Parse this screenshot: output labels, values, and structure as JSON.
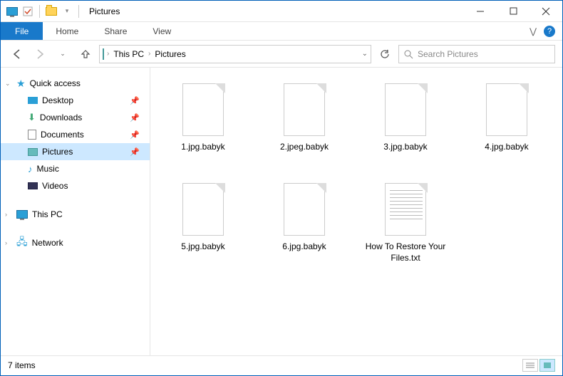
{
  "window": {
    "title": "Pictures"
  },
  "ribbon": {
    "file": "File",
    "tabs": [
      "Home",
      "Share",
      "View"
    ]
  },
  "breadcrumb": {
    "root": "This PC",
    "current": "Pictures"
  },
  "search": {
    "placeholder": "Search Pictures"
  },
  "sidebar": {
    "quick": "Quick access",
    "quick_items": [
      {
        "label": "Desktop",
        "pinned": true
      },
      {
        "label": "Downloads",
        "pinned": true
      },
      {
        "label": "Documents",
        "pinned": true
      },
      {
        "label": "Pictures",
        "pinned": true,
        "selected": true
      },
      {
        "label": "Music",
        "pinned": false
      },
      {
        "label": "Videos",
        "pinned": false
      }
    ],
    "thispc": "This PC",
    "network": "Network"
  },
  "files": [
    {
      "name": "1.jpg.babyk",
      "type": "blank"
    },
    {
      "name": "2.jpeg.babyk",
      "type": "blank"
    },
    {
      "name": "3.jpg.babyk",
      "type": "blank"
    },
    {
      "name": "4.jpg.babyk",
      "type": "blank"
    },
    {
      "name": "5.jpg.babyk",
      "type": "blank"
    },
    {
      "name": "6.jpg.babyk",
      "type": "blank"
    },
    {
      "name": "How To Restore Your Files.txt",
      "type": "text"
    }
  ],
  "status": {
    "count": "7 items"
  }
}
